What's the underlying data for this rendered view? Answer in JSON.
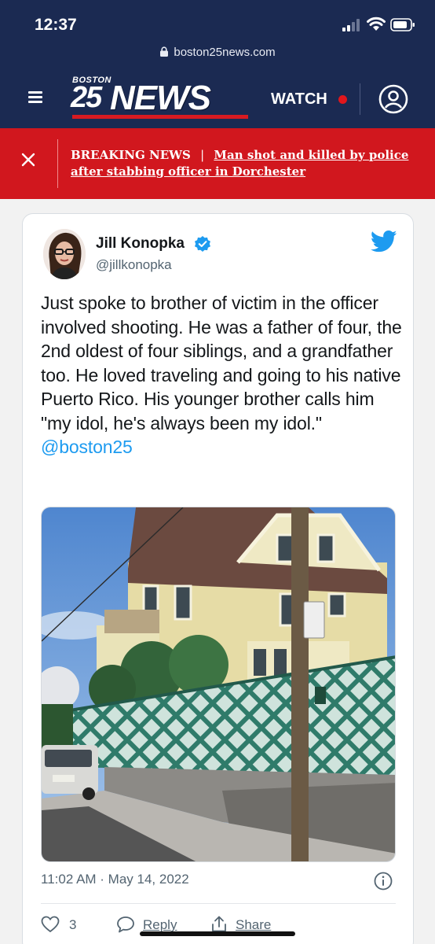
{
  "status_bar": {
    "time": "12:37"
  },
  "browser": {
    "url": "boston25news.com"
  },
  "header": {
    "logo_small": "BOSTON",
    "logo_number": "25",
    "logo_word": "NEWS",
    "watch_label": "WATCH",
    "colors": {
      "background": "#1b2a52",
      "accent": "#d71a21"
    }
  },
  "breaking": {
    "label": "BREAKING NEWS",
    "separator": "|",
    "headline": "Man shot and killed by police after stabbing officer in Dorchester",
    "color": "#d1171e"
  },
  "tweet": {
    "author_name": "Jill Konopka",
    "handle": "@jillkonopka",
    "text": "Just spoke to brother of victim in the officer involved shooting. He was a father of four, the 2nd oldest of four siblings, and a grandfather too. He loved traveling and going to his native Puerto Rico.  His younger brother calls him \"my idol, he's always been my idol.\"",
    "mention": "@boston25",
    "timestamp": "11:02 AM · May 14, 2022",
    "like_count": "3",
    "reply_label": "Reply",
    "share_label": "Share",
    "accent_color": "#1d9bf0",
    "icons": [
      "verified-badge-icon",
      "twitter-bird-icon",
      "info-icon",
      "heart-icon",
      "reply-bubble-icon",
      "share-icon"
    ]
  }
}
